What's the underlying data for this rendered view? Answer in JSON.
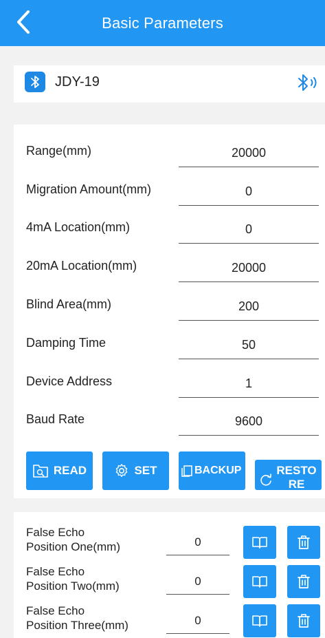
{
  "header": {
    "title": "Basic Parameters",
    "back_icon": "chevron-left-icon"
  },
  "device": {
    "name": "JDY-19",
    "badge_icon": "bluetooth-icon",
    "status_icon": "bluetooth-connected-icon"
  },
  "params": [
    {
      "label": "Range(mm)",
      "value": "20000"
    },
    {
      "label": "Migration Amount(mm)",
      "value": "0"
    },
    {
      "label": "4mA Location(mm)",
      "value": "0"
    },
    {
      "label": "20mA Location(mm)",
      "value": "20000"
    },
    {
      "label": "Blind Area(mm)",
      "value": "200"
    },
    {
      "label": "Damping Time",
      "value": "50"
    },
    {
      "label": "Device Address",
      "value": "1"
    },
    {
      "label": "Baud Rate",
      "value": "9600"
    }
  ],
  "actions": {
    "read": "READ",
    "set": "SET",
    "backup": "BACKUP",
    "restore": "RESTORE"
  },
  "false_echo": [
    {
      "label_line1": "False Echo",
      "label_line2": "Position One(mm)",
      "value": "0"
    },
    {
      "label_line1": "False Echo",
      "label_line2": "Position Two(mm)",
      "value": "0"
    },
    {
      "label_line1": "False Echo",
      "label_line2": "Position Three(mm)",
      "value": "0"
    }
  ],
  "colors": {
    "primary": "#2196f3",
    "badge": "#1e88e5",
    "background": "#f2f2f2"
  }
}
